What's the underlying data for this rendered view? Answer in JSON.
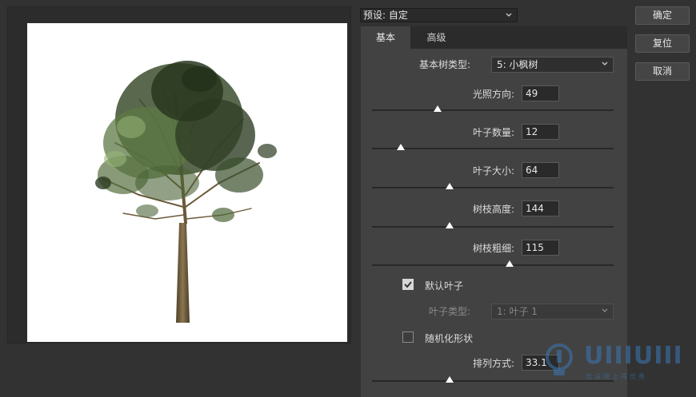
{
  "preset": {
    "label": "预设: 自定"
  },
  "buttons": {
    "ok": "确定",
    "reset": "复位",
    "cancel": "取消"
  },
  "tabs": [
    {
      "label": "基本"
    },
    {
      "label": "高级"
    }
  ],
  "basic": {
    "tree_type": {
      "label": "基本树类型:",
      "value": "5: 小枫树"
    },
    "sliders": [
      {
        "label": "光照方向:",
        "value": "49",
        "level": 0.27
      },
      {
        "label": "叶子数量:",
        "value": "12",
        "level": 0.12
      },
      {
        "label": "叶子大小:",
        "value": "64",
        "level": 0.32
      },
      {
        "label": "树枝高度:",
        "value": "144",
        "level": 0.32
      },
      {
        "label": "树枝粗细:",
        "value": "115",
        "level": 0.57
      }
    ],
    "default_leaves": {
      "label": "默认叶子",
      "checked": true
    },
    "leaf_type": {
      "label": "叶子类型:",
      "value": "1: 叶子 1",
      "enabled": false
    },
    "randomize": {
      "label": "随机化形状",
      "checked": false
    },
    "arrangement": {
      "label": "排列方式:",
      "value": "33.1",
      "level": 0.32
    }
  },
  "watermark": {
    "text": "UIIIUIII",
    "subtext": "优设网上得优秀"
  },
  "colors": {
    "panel": "#424242",
    "background": "#323232",
    "foliage_dark": "#2c3b22",
    "foliage_light": "#8aa56b",
    "trunk": "#6b5a38"
  },
  "icons": {
    "dropdown": "chevron-down-icon",
    "checkbox_checked": "check-icon",
    "slider": "triangle-thumb-icon"
  }
}
